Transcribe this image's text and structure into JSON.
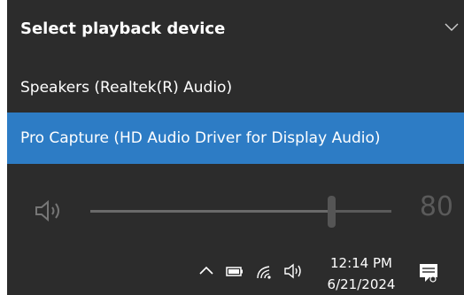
{
  "flyout": {
    "title": "Select playback device",
    "devices": [
      {
        "label": "Speakers (Realtek(R) Audio)",
        "selected": false
      },
      {
        "label": "Pro Capture (HD Audio Driver for Display Audio)",
        "selected": true
      }
    ],
    "volume": {
      "value": "80",
      "level": 0.8,
      "disabled": true
    }
  },
  "taskbar": {
    "time": "12:14 PM",
    "date": "6/21/2024",
    "icons": [
      "chevron-up-icon",
      "battery-icon",
      "wifi-icon",
      "speaker-icon",
      "notification-icon"
    ]
  },
  "colors": {
    "background": "#2c2c2c",
    "accent": "#2d7cc5",
    "text": "#ffffff",
    "disabled": "#5a5a5a"
  }
}
